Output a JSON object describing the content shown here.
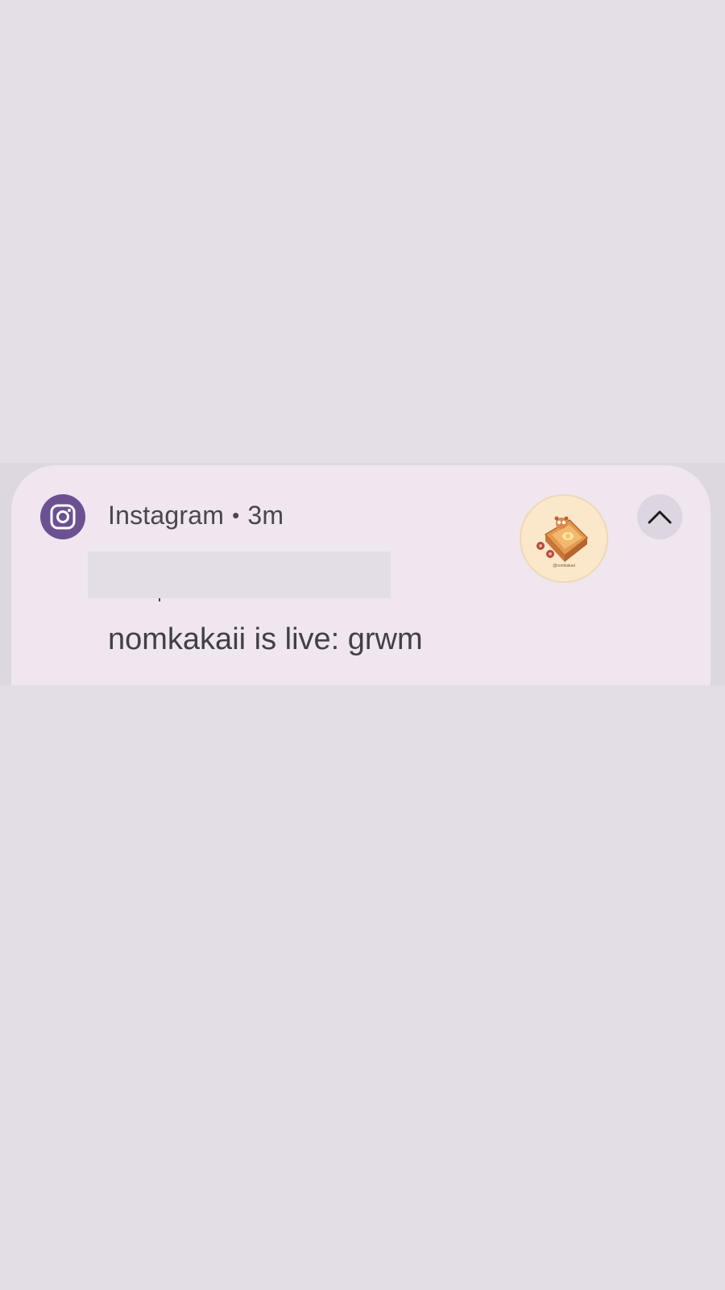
{
  "notification": {
    "app_name": "Instagram",
    "separator": "•",
    "time": "3m",
    "message": "nomkakaii is live: grwm",
    "app_icon": "instagram-icon",
    "avatar": "avatar-bread-illustration",
    "avatar_caption": "@nomkakaii",
    "expand_icon": "chevron-up-icon"
  },
  "colors": {
    "background": "#e3dee6",
    "card": "#efe6ef",
    "app_icon_bg": "#6c5192",
    "text": "#4a454e"
  }
}
